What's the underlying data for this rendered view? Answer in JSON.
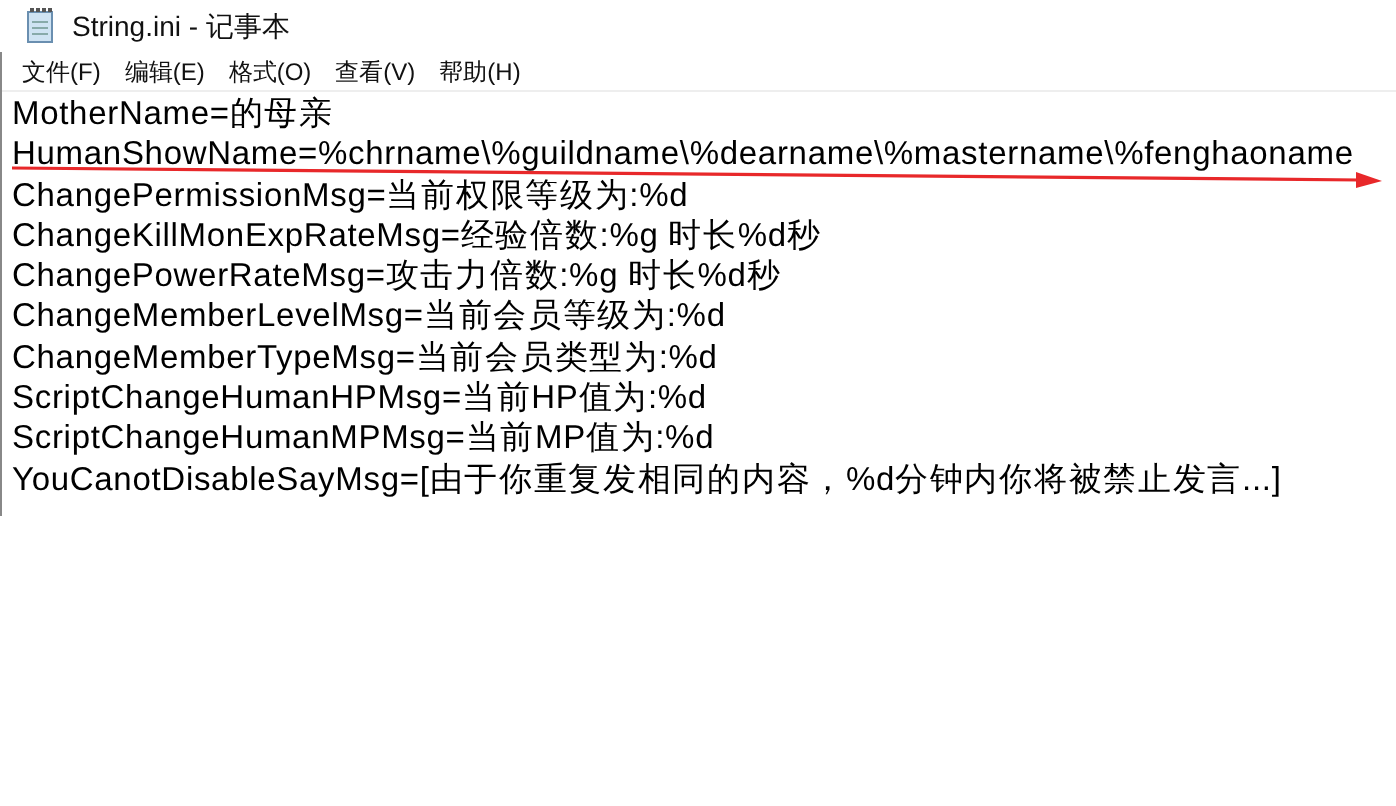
{
  "window": {
    "title": "String.ini - 记事本"
  },
  "menu": [
    "文件(F)",
    "编辑(E)",
    "格式(O)",
    "查看(V)",
    "帮助(H)"
  ],
  "editor": {
    "lines": [
      "MotherName=的母亲",
      "HumanShowName=%chrname\\%guildname\\%dearname\\%mastername\\%fenghaoname",
      "ChangePermissionMsg=当前权限等级为:%d",
      "ChangeKillMonExpRateMsg=经验倍数:%g 时长%d秒",
      "ChangePowerRateMsg=攻击力倍数:%g 时长%d秒",
      "ChangeMemberLevelMsg=当前会员等级为:%d",
      "ChangeMemberTypeMsg=当前会员类型为:%d",
      "ScriptChangeHumanHPMsg=当前HP值为:%d",
      "ScriptChangeHumanMPMsg=当前MP值为:%d",
      "YouCanotDisableSayMsg=[由于你重复发相同的内容，%d分钟内你将被禁止发言...]"
    ]
  }
}
